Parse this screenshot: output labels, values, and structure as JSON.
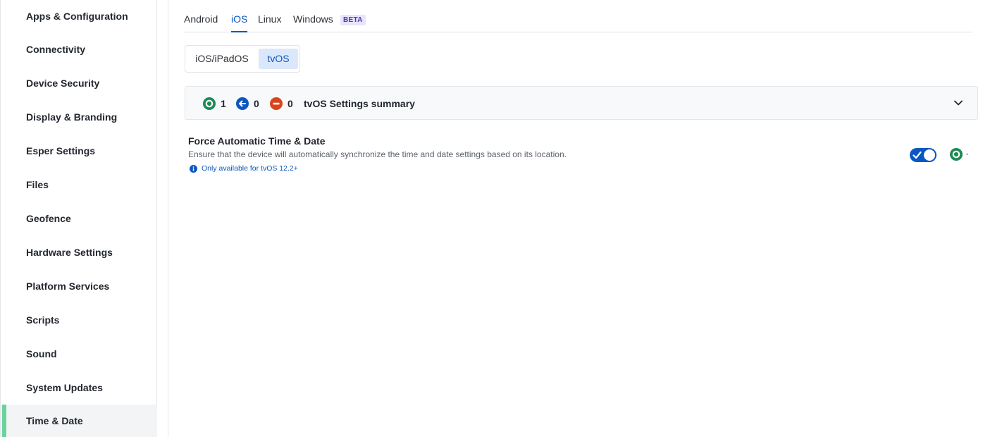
{
  "sidebar": {
    "items": [
      {
        "label": "Apps & Configuration",
        "active": false
      },
      {
        "label": "Connectivity",
        "active": false
      },
      {
        "label": "Device Security",
        "active": false
      },
      {
        "label": "Display & Branding",
        "active": false
      },
      {
        "label": "Esper Settings",
        "active": false
      },
      {
        "label": "Files",
        "active": false
      },
      {
        "label": "Geofence",
        "active": false
      },
      {
        "label": "Hardware Settings",
        "active": false
      },
      {
        "label": "Platform Services",
        "active": false
      },
      {
        "label": "Scripts",
        "active": false
      },
      {
        "label": "Sound",
        "active": false
      },
      {
        "label": "System Updates",
        "active": false
      },
      {
        "label": "Time & Date",
        "active": true
      }
    ]
  },
  "os_tabs": {
    "items": [
      {
        "label": "Android",
        "active": false
      },
      {
        "label": "iOS",
        "active": true
      },
      {
        "label": "Linux",
        "active": false
      },
      {
        "label": "Windows",
        "active": false
      }
    ],
    "beta_badge": "BETA"
  },
  "platform_toggle": {
    "options": [
      {
        "label": "iOS/iPadOS",
        "active": false
      },
      {
        "label": "tvOS",
        "active": true
      }
    ]
  },
  "summary": {
    "enforced_count": "1",
    "inherited_count": "0",
    "removed_count": "0",
    "title": "tvOS Settings summary",
    "icons": [
      "enforced-status-icon",
      "inherited-status-icon",
      "removed-status-icon",
      "chevron-down-icon"
    ]
  },
  "setting": {
    "title": "Force Automatic Time & Date",
    "description": "Ensure that the device will automatically synchronize the time and date settings based on its location.",
    "availability_note": "Only available for tvOS 12.2+",
    "enabled": true
  },
  "colors": {
    "accent": "#0b57c2",
    "enforced_green": "#1e8a56",
    "inherited_blue": "#0b57c2",
    "removed_red": "#d9451d",
    "active_sidebar_marker": "#6ad39c",
    "beta_badge_bg": "#e9e4fb"
  }
}
